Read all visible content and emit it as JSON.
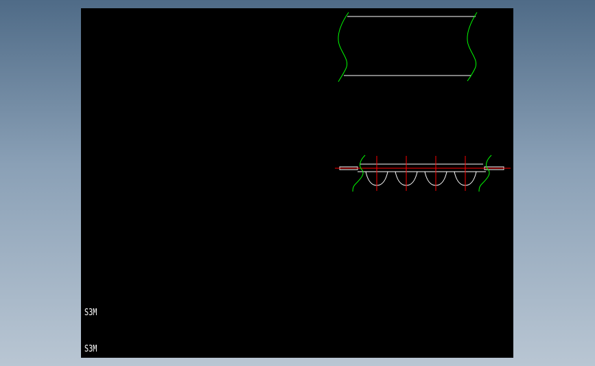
{
  "drawing": {
    "labels": [
      "S3M",
      "S3M"
    ],
    "colors": {
      "background": "#000000",
      "outline": "#ffffff",
      "break_line": "#00ff00",
      "center_line": "#ff0000",
      "frame_bg": "#8aa0b6"
    }
  }
}
